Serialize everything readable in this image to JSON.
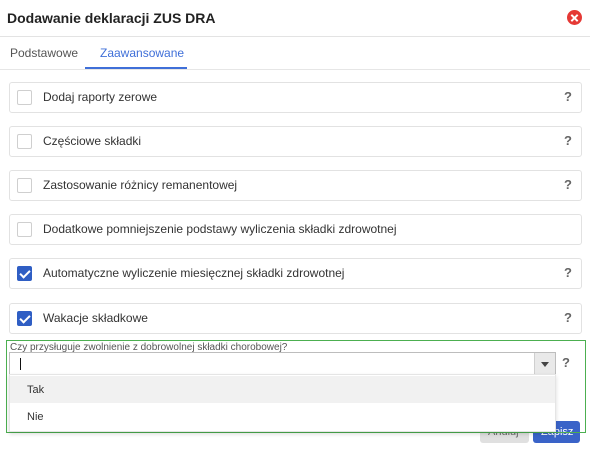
{
  "dialog": {
    "title": "Dodawanie deklaracji ZUS DRA"
  },
  "tabs": [
    {
      "label": "Podstawowe"
    },
    {
      "label": "Zaawansowane"
    }
  ],
  "options": [
    {
      "label": "Dodaj raporty zerowe",
      "checked": false,
      "help": "?"
    },
    {
      "label": "Częściowe składki",
      "checked": false,
      "help": "?"
    },
    {
      "label": "Zastosowanie różnicy remanentowej",
      "checked": false,
      "help": "?"
    },
    {
      "label": "Dodatkowe pomniejszenie podstawy wyliczenia składki zdrowotnej",
      "checked": false,
      "help": ""
    },
    {
      "label": "Automatyczne wyliczenie miesięcznej składki zdrowotnej",
      "checked": true,
      "help": "?"
    },
    {
      "label": "Wakacje składkowe",
      "checked": true,
      "help": "?"
    }
  ],
  "exemption": {
    "label": "Czy przysługuje zwolnienie z dobrowolnej składki chorobowej?",
    "value": "",
    "help": "?",
    "dropdown_options": [
      "Tak",
      "Nie"
    ]
  },
  "footer": {
    "cancel_label": "Anuluj",
    "save_label": "Zapisz"
  },
  "colors": {
    "accent": "#3f6fd8",
    "highlight_border": "#4caf50",
    "close": "#e53935"
  }
}
